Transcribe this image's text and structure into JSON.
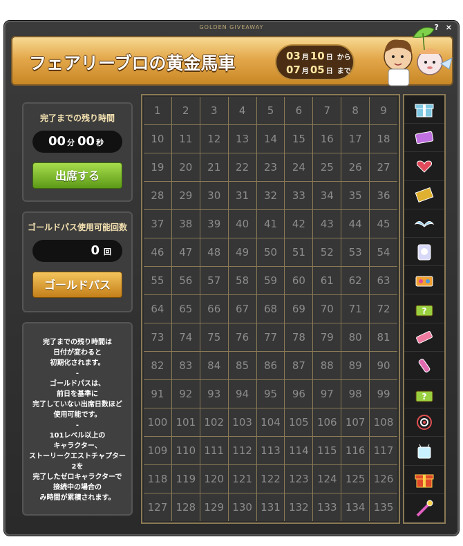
{
  "window": {
    "title": "GOLDEN GIVEAWAY",
    "help_label": "?",
    "close_label": "×"
  },
  "banner": {
    "title": "フェアリーブロの黄金馬車",
    "start": {
      "month": "03",
      "month_unit": "月",
      "day": "10",
      "day_unit": "日",
      "suffix": "から"
    },
    "end": {
      "month": "07",
      "month_unit": "月",
      "day": "05",
      "day_unit": "日",
      "suffix": "まで"
    }
  },
  "timer_panel": {
    "label": "完了までの残り時間",
    "minutes": "00",
    "minutes_unit": "分",
    "seconds": "00",
    "seconds_unit": "秒",
    "attend_button": "出席する"
  },
  "pass_panel": {
    "label": "ゴールドパス使用可能回数",
    "count": "0",
    "count_unit": "回",
    "pass_button": "ゴールドパス"
  },
  "info_lines": [
    "完了までの残り時間は",
    "日付が変わると",
    "初期化されます。",
    "-",
    "ゴールドパスは、",
    "前日を基準に",
    "完了していない出席日数ほど",
    "使用可能です。",
    "-",
    "101レベル以上の",
    "キャラクター、",
    "ストーリークエストチャプター2を",
    "完了したゼロキャラクターで",
    "接続中の場合の",
    "み時間が累積されます。"
  ],
  "days": [
    "1",
    "2",
    "3",
    "4",
    "5",
    "6",
    "7",
    "8",
    "9",
    "10",
    "11",
    "12",
    "13",
    "14",
    "15",
    "16",
    "17",
    "18",
    "19",
    "20",
    "21",
    "22",
    "23",
    "24",
    "25",
    "26",
    "27",
    "28",
    "29",
    "30",
    "31",
    "32",
    "33",
    "34",
    "35",
    "36",
    "37",
    "38",
    "39",
    "40",
    "41",
    "42",
    "43",
    "44",
    "45",
    "46",
    "47",
    "48",
    "49",
    "50",
    "51",
    "52",
    "53",
    "54",
    "55",
    "56",
    "57",
    "58",
    "59",
    "60",
    "61",
    "62",
    "63",
    "64",
    "65",
    "66",
    "67",
    "68",
    "69",
    "70",
    "71",
    "72",
    "73",
    "74",
    "75",
    "76",
    "77",
    "78",
    "79",
    "80",
    "81",
    "82",
    "83",
    "84",
    "85",
    "86",
    "87",
    "88",
    "89",
    "90",
    "91",
    "92",
    "93",
    "94",
    "95",
    "96",
    "97",
    "98",
    "99",
    "100",
    "101",
    "102",
    "103",
    "104",
    "105",
    "106",
    "107",
    "108",
    "109",
    "110",
    "111",
    "112",
    "113",
    "114",
    "115",
    "116",
    "117",
    "118",
    "119",
    "120",
    "121",
    "122",
    "123",
    "124",
    "125",
    "126",
    "127",
    "128",
    "129",
    "130",
    "131",
    "132",
    "133",
    "134",
    "135"
  ],
  "rewards": [
    {
      "icon": "gift-box-icon",
      "color": "#7ec8e3"
    },
    {
      "icon": "ticket-icon",
      "color": "#c070e0"
    },
    {
      "icon": "hearts-icon",
      "color": "#e04a5a"
    },
    {
      "icon": "coupon-icon",
      "color": "#e0b030"
    },
    {
      "icon": "wings-icon",
      "color": "#9ad0f0"
    },
    {
      "icon": "card-icon",
      "color": "#d8d8f8"
    },
    {
      "icon": "potion-box-icon",
      "color": "#f0a030"
    },
    {
      "icon": "mystery-chest-icon",
      "color": "#9ad040"
    },
    {
      "icon": "pink-ticket-icon",
      "color": "#f07aa0"
    },
    {
      "icon": "scroll-icon",
      "color": "#e06ab0"
    },
    {
      "icon": "mystery-chest-icon",
      "color": "#9ad040"
    },
    {
      "icon": "target-icon",
      "color": "#e05050"
    },
    {
      "icon": "crystal-box-icon",
      "color": "#c8f0ff"
    },
    {
      "icon": "red-gift-icon",
      "color": "#e04a2a"
    },
    {
      "icon": "wand-icon",
      "color": "#e060c0"
    }
  ]
}
